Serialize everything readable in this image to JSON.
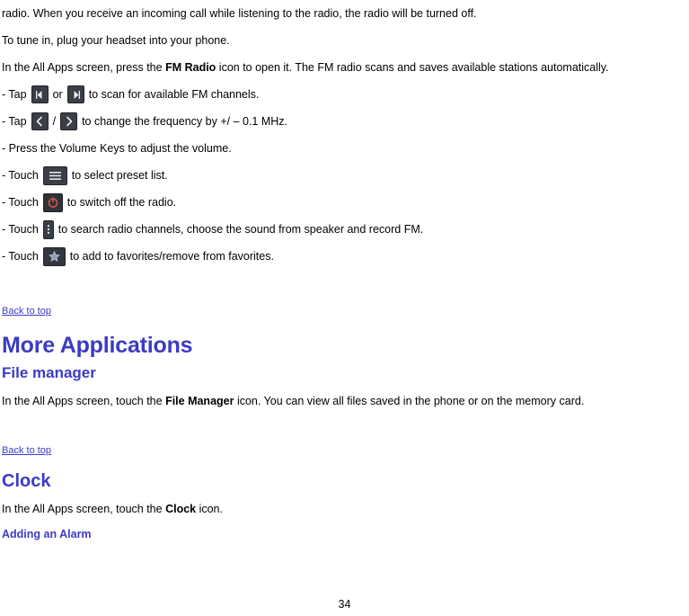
{
  "document": {
    "intro_paragraph": "radio. When you receive an incoming call while listening to the radio, the radio will be turned off.",
    "tune_in_paragraph": "To tune in, plug your headset into your phone.",
    "all_apps_part1": "In the All Apps screen, press the ",
    "all_apps_bold": "FM Radio",
    "all_apps_part2": " icon to open it. The FM radio scans and saves available stations automatically.",
    "bullets": [
      {
        "prefix": "- Tap",
        "icons": [
          "scan-left-icon",
          "scan-right-icon"
        ],
        "middle": "or",
        "suffix": "to scan for available FM channels."
      },
      {
        "prefix": "- Tap",
        "icons": [
          "prev-station-icon",
          "next-station-icon"
        ],
        "middle": "/",
        "suffix": "to change the frequency by +/ – 0.1 MHz."
      },
      {
        "text": "- Press the Volume Keys to adjust the volume."
      },
      {
        "prefix": "- Touch",
        "icons": [
          "preset-list-icon"
        ],
        "suffix": "to select preset list."
      },
      {
        "prefix": "- Touch",
        "icons": [
          "power-off-icon"
        ],
        "suffix": "to switch off the radio."
      },
      {
        "prefix": "- Touch",
        "icons": [
          "search-icon"
        ],
        "suffix": "to search radio channels, choose the sound from speaker and record FM."
      },
      {
        "prefix": "- Touch",
        "icons": [
          "favorite-star-icon"
        ],
        "suffix": "to add to favorites/remove from favorites."
      }
    ],
    "back_to_top_1": "Back to top",
    "more_applications_heading": "More Applications",
    "file_manager_heading": "File manager",
    "file_manager_part1": "In the All Apps screen, touch the ",
    "file_manager_bold": "File Manager",
    "file_manager_part2": " icon. You can view all files saved in the phone or on the memory card.",
    "back_to_top_2": "Back to top",
    "clock_heading": "Clock",
    "clock_part1": "In the All Apps screen, touch the ",
    "clock_bold": "Clock",
    "clock_part2": " icon.",
    "adding_alarm_heading": "Adding an Alarm",
    "page_number": "34"
  },
  "colors": {
    "heading": "#3b3bc4",
    "link": "#3b3bc4",
    "text": "#000000",
    "background": "#ffffff"
  }
}
